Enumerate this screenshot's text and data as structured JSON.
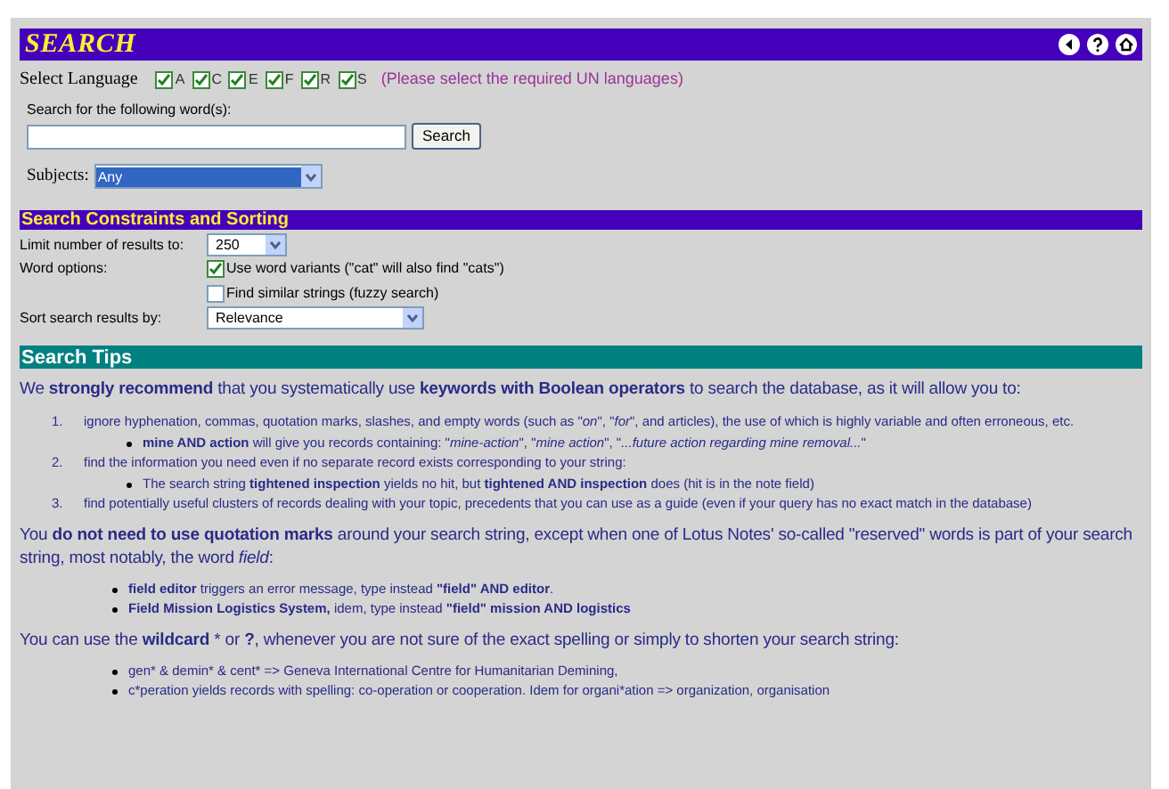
{
  "title": "SEARCH",
  "language": {
    "label": "Select Language",
    "options": [
      {
        "code": "A",
        "checked": true
      },
      {
        "code": "C",
        "checked": true
      },
      {
        "code": "E",
        "checked": true
      },
      {
        "code": "F",
        "checked": true
      },
      {
        "code": "R",
        "checked": true
      },
      {
        "code": "S",
        "checked": true
      }
    ],
    "hint": "(Please select the required UN languages)"
  },
  "search": {
    "label": "Search for the following word(s):",
    "button": "Search"
  },
  "subjects": {
    "label": "Subjects:",
    "value": "Any"
  },
  "constraints": {
    "heading": "Search Constraints and Sorting",
    "limit_label": "Limit number of results to:",
    "limit_value": "250",
    "word_options_label": "Word options:",
    "word_options": [
      {
        "label": "Use word variants (\"cat\" will also find \"cats\")",
        "checked": true
      },
      {
        "label": "Find similar strings (fuzzy search)",
        "checked": false
      }
    ],
    "sort_label": "Sort search results by:",
    "sort_value": "Relevance"
  },
  "tips": {
    "heading": "Search Tips",
    "blocks": [
      {
        "kind": "paragraph",
        "text": "We **strongly recommend** that you systematically use **keywords with Boolean operators** to search the database, as it will allow you to:"
      },
      {
        "kind": "ordered",
        "items": [
          {
            "number": "1.",
            "text": "ignore hyphenation, commas, quotation marks, slashes, and empty words (such as \"*on*\", \"*for*\", and articles), the use of which is highly variable and often erroneous, etc.",
            "children": [
              "**mine AND action** will give you records containing: \"*mine-action*\", \"*mine action*\", \"*...future action regarding mine removal...*\""
            ]
          },
          {
            "number": "2.",
            "text": "find the information you need even if no separate record exists corresponding to your string:",
            "children": [
              "The search string **tightened inspection** yields no hit, but **tightened AND inspection** does (hit is in the note field)"
            ]
          },
          {
            "number": "3.",
            "text": "find potentially useful clusters of records dealing with your topic, precedents that you can use as a guide (even if your query has no exact match in the database)"
          }
        ]
      },
      {
        "kind": "paragraph",
        "text": "You **do not need to use quotation marks** around your search string, except when one of Lotus Notes' so-called \"reserved\" words is part of your search string, most notably, the word *field*:"
      },
      {
        "kind": "bullets",
        "items": [
          "**field editor** triggers an error message, type instead **\"field\" AND editor**.",
          "**Field Mission Logistics System,** idem, type instead **\"field\" mission AND logistics**"
        ]
      },
      {
        "kind": "paragraph",
        "text": "You can use the **wildcard** * or **?**, whenever you are not sure of the exact spelling or simply to shorten your search string:"
      },
      {
        "kind": "bullets",
        "items": [
          "gen* & demin* & cent* => Geneva International Centre for Humanitarian Demining,",
          "c*peration yields records with spelling: co-operation or cooperation. Idem for organi*ation => organization, organisation"
        ]
      }
    ]
  }
}
